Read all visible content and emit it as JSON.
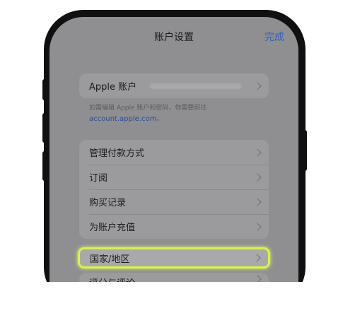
{
  "nav": {
    "title": "账户设置",
    "done": "完成"
  },
  "apple_account": {
    "label": "Apple 账户",
    "note": "如需编辑 Apple 账户和密码，你需要前往",
    "link": "account.apple.com",
    "link_suffix": "。"
  },
  "payment_group": {
    "items": [
      "管理付款方式",
      "订阅",
      "购买记录",
      "为账户充值"
    ]
  },
  "region": {
    "label": "国家/地区"
  },
  "next_row": {
    "label": "评分与评论"
  },
  "colors": {
    "highlight": "#d7f542",
    "accent": "#2f63c2"
  }
}
